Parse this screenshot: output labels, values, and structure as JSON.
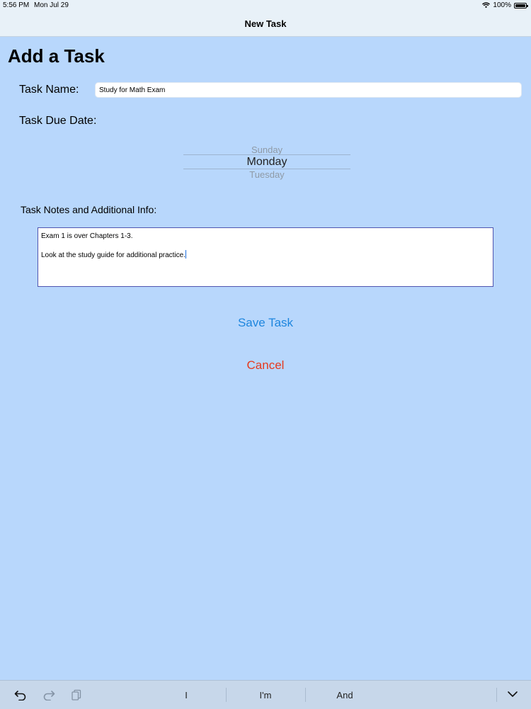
{
  "status": {
    "time": "5:56 PM",
    "date": "Mon Jul 29",
    "battery": "100%"
  },
  "nav": {
    "title": "New Task"
  },
  "page": {
    "title": "Add a Task"
  },
  "form": {
    "name_label": "Task Name:",
    "name_value": "Study for Math Exam",
    "due_label": "Task Due Date:",
    "picker": {
      "prev": "Sunday",
      "selected": "Monday",
      "next": "Tuesday"
    },
    "notes_label": "Task Notes and Additional Info:",
    "notes_lines": [
      "Exam 1 is over Chapters 1-3.",
      "Look at the study guide for additional practice."
    ]
  },
  "actions": {
    "save": "Save Task",
    "cancel": "Cancel"
  },
  "keyboard": {
    "suggestions": [
      "I",
      "I'm",
      "And"
    ],
    "icons": [
      "undo-icon",
      "redo-icon",
      "paste-icon",
      "dismiss-keyboard-icon"
    ]
  },
  "colors": {
    "background": "#b8d7fc",
    "save_accent": "#1e86de",
    "cancel_accent": "#e53a1e"
  }
}
